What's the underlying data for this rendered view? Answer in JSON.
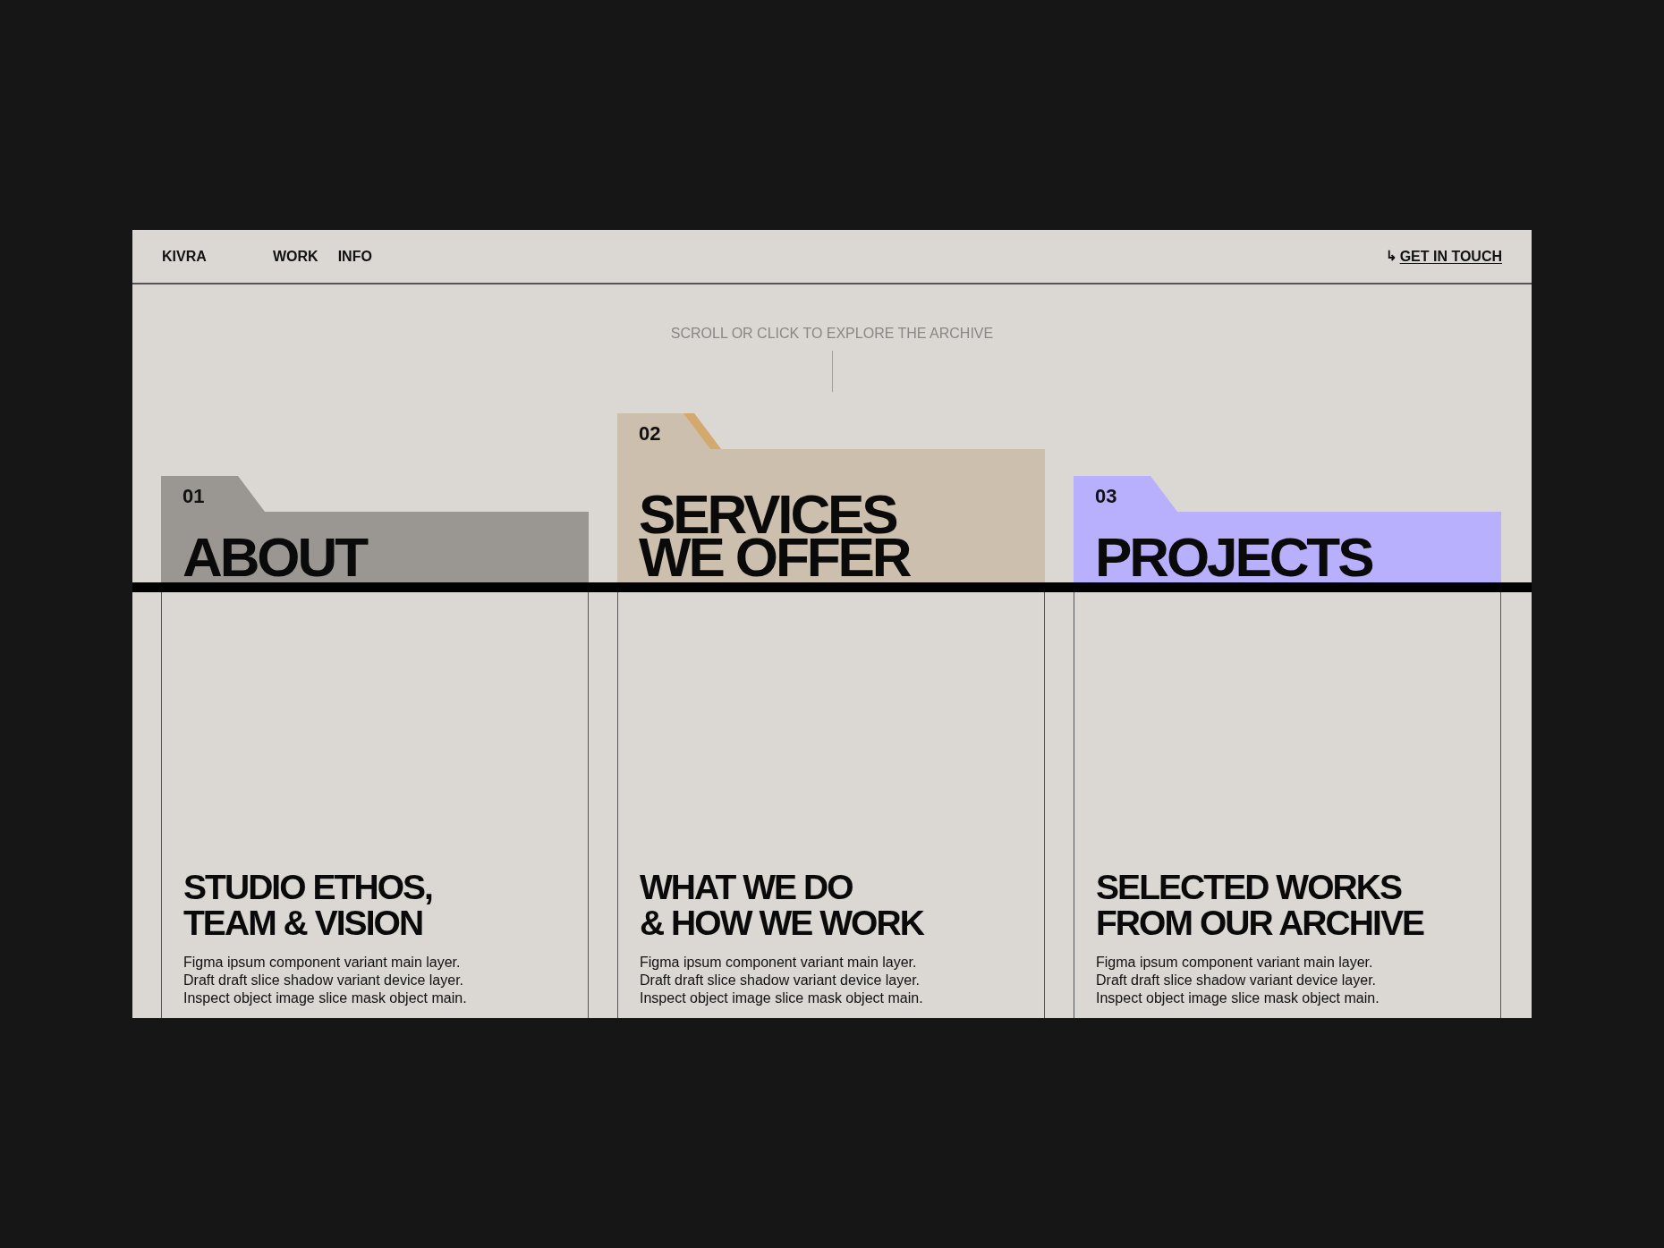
{
  "header": {
    "brand": "KIVRA",
    "nav": [
      "WORK",
      "INFO"
    ],
    "cta_icon": "↳",
    "cta": "GET IN TOUCH"
  },
  "hint": "SCROLL OR CLICK TO EXPLORE THE ARCHIVE",
  "folders": [
    {
      "number": "01",
      "title": "ABOUT",
      "color": "#9a9692",
      "selected": false,
      "heading": "STUDIO ETHOS,\nTEAM & VISION",
      "body": "Figma ipsum component variant main layer.\nDraft draft slice shadow variant device layer.\nInspect object image slice mask object main."
    },
    {
      "number": "02",
      "title": "SERVICES\nWE OFFER",
      "color": "#cdbfae",
      "selected": true,
      "heading": "WHAT WE DO\n& HOW WE WORK",
      "body": "Figma ipsum component variant main layer.\nDraft draft slice shadow variant device layer.\nInspect object image slice mask object main."
    },
    {
      "number": "03",
      "title": "PROJECTS",
      "color": "#b8b0fd",
      "selected": false,
      "heading": "SELECTED WORKS\nFROM OUR ARCHIVE",
      "body": "Figma ipsum component variant main layer.\nDraft draft slice shadow variant device layer.\nInspect object image slice mask object main."
    }
  ]
}
